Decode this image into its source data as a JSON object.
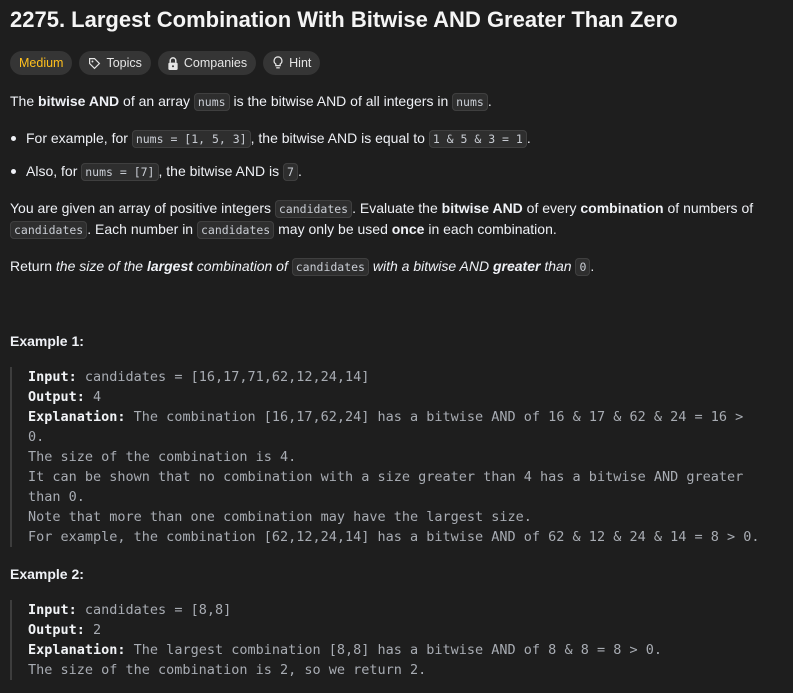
{
  "problem": {
    "title": "2275. Largest Combination With Bitwise AND Greater Than Zero",
    "tags": {
      "difficulty": "Medium",
      "topics": "Topics",
      "companies": "Companies",
      "hint": "Hint"
    }
  },
  "description": {
    "p1": {
      "a": "The ",
      "b_bold": "bitwise AND",
      "c": " of an array ",
      "d_code": "nums",
      "e": " is the bitwise AND of all integers in ",
      "f_code": "nums",
      "g": "."
    },
    "bullet1": {
      "a": "For example, for ",
      "b_code": "nums = [1, 5, 3]",
      "c": ", the bitwise AND is equal to ",
      "d_code": "1 & 5 & 3 = 1",
      "e": "."
    },
    "bullet2": {
      "a": "Also, for ",
      "b_code": "nums = [7]",
      "c": ", the bitwise AND is ",
      "d_code": "7",
      "e": "."
    },
    "p2": {
      "a": "You are given an array of positive integers ",
      "b_code": "candidates",
      "c": ". Evaluate the ",
      "d_bold": "bitwise AND",
      "e": " of every ",
      "f_bold": "combination",
      "g": " of numbers of",
      "h_code": "candidates",
      "i": ". Each number in ",
      "j_code": "candidates",
      "k": " may only be used ",
      "l_bold": "once",
      "m": " in each combination."
    },
    "p3": {
      "a": "Return ",
      "b_ital": "the size of the ",
      "c_boldital": "largest",
      "d_ital": " combination of ",
      "e_code": "candidates",
      "f_ital": " with a bitwise AND ",
      "g_boldital": "greater",
      "h_ital": " than ",
      "i_code": "0",
      "j": "."
    }
  },
  "examples": [
    {
      "title": "Example 1:",
      "input_label": "Input:",
      "input_value": " candidates = [16,17,71,62,12,24,14]",
      "output_label": "Output:",
      "output_value": " 4",
      "explanation_label": "Explanation:",
      "explanation_first": " The combination [16,17,62,24] has a bitwise AND of 16 & 17 & 62 & 24 = 16 >",
      "explanation_lines": [
        "0.",
        "The size of the combination is 4.",
        "It can be shown that no combination with a size greater than 4 has a bitwise AND greater",
        "than 0.",
        "Note that more than one combination may have the largest size.",
        "For example, the combination [62,12,24,14] has a bitwise AND of 62 & 12 & 24 & 14 = 8 > 0."
      ]
    },
    {
      "title": "Example 2:",
      "input_label": "Input:",
      "input_value": " candidates = [8,8]",
      "output_label": "Output:",
      "output_value": " 2",
      "explanation_label": "Explanation:",
      "explanation_first": " The largest combination [8,8] has a bitwise AND of 8 & 8 = 8 > 0.",
      "explanation_lines": [
        "The size of the combination is 2, so we return 2."
      ]
    }
  ],
  "icons": {
    "topics": "tag-icon",
    "companies": "lock-icon",
    "hint": "lightbulb-icon"
  },
  "colors": {
    "background": "#1e1e1e",
    "difficulty_medium": "#ffc01e",
    "tag_bg": "#353535"
  }
}
